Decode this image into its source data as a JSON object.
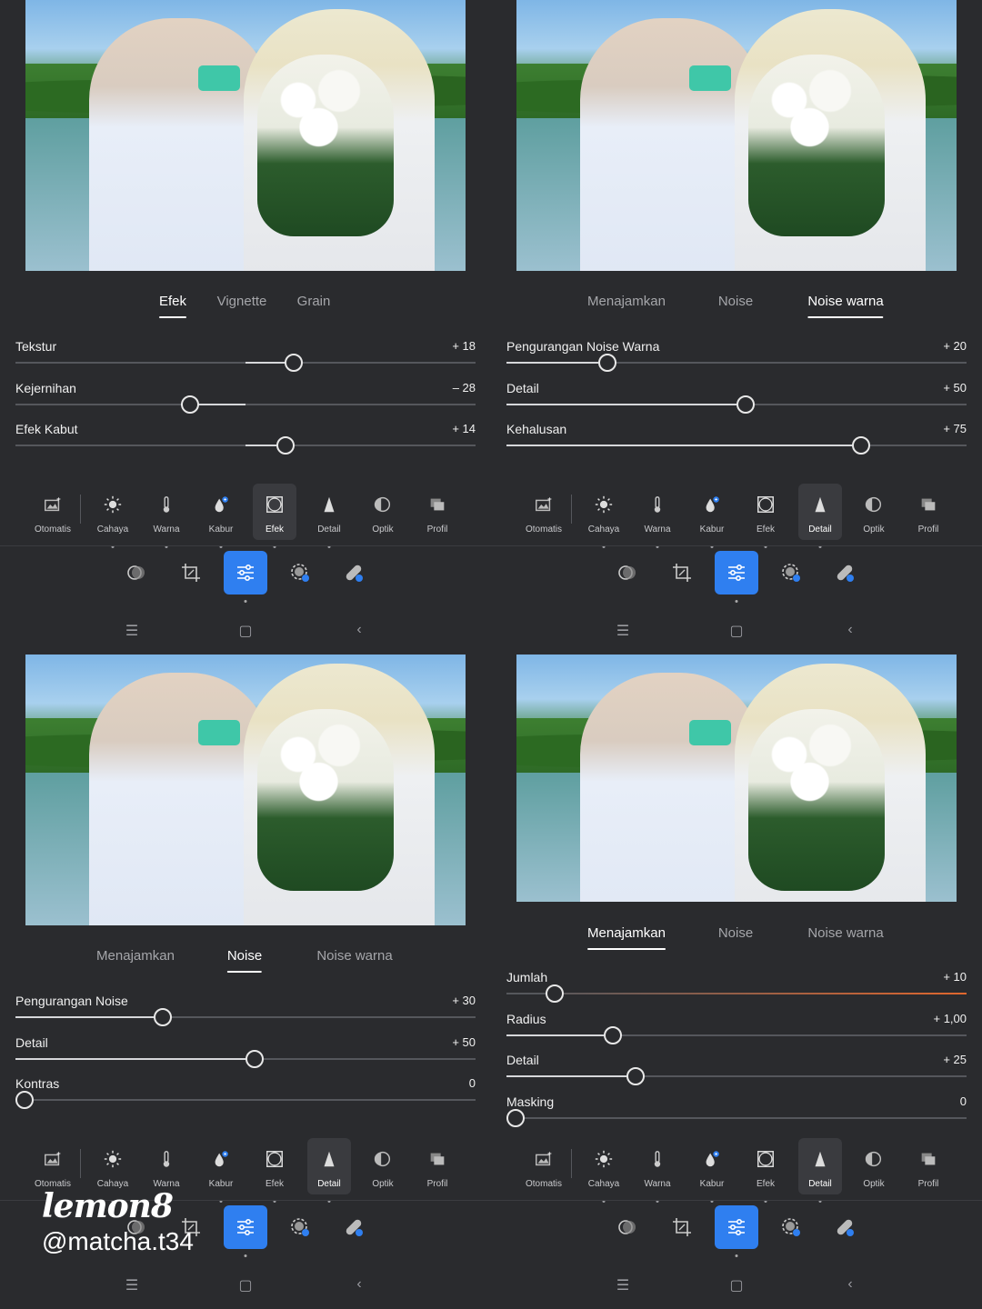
{
  "toolbar": [
    {
      "id": "otomatis",
      "label": "Otomatis",
      "icon": "auto-photo-icon"
    },
    {
      "id": "cahaya",
      "label": "Cahaya",
      "icon": "sun-icon"
    },
    {
      "id": "warna",
      "label": "Warna",
      "icon": "thermometer-icon"
    },
    {
      "id": "kabur",
      "label": "Kabur",
      "icon": "blur-drop-icon"
    },
    {
      "id": "efek",
      "label": "Efek",
      "icon": "vignette-frame-icon"
    },
    {
      "id": "detail",
      "label": "Detail",
      "icon": "triangle-detail-icon"
    },
    {
      "id": "optik",
      "label": "Optik",
      "icon": "lens-icon"
    },
    {
      "id": "profil",
      "label": "Profil",
      "icon": "profile-stack-icon"
    }
  ],
  "bottom_tools": [
    "presets-icon",
    "crop-icon",
    "edit-sliders-icon",
    "masking-icon",
    "healing-icon"
  ],
  "nav": {
    "menu": "☰",
    "home": "▢",
    "back": "‹"
  },
  "panels": [
    {
      "active_tool": "efek",
      "tabs": [
        "Efek",
        "Vignette",
        "Grain"
      ],
      "active_tab": 0,
      "sliders": [
        {
          "label": "Tekstur",
          "value": "+ 18",
          "pos": 0.585
        },
        {
          "label": "Kejernihan",
          "value": "– 28",
          "pos": 0.36
        },
        {
          "label": "Efek Kabut",
          "value": "+ 14",
          "pos": 0.568
        }
      ]
    },
    {
      "active_tool": "detail",
      "tabs": [
        "Menajamkan",
        "Noise",
        "Noise warna"
      ],
      "active_tab": 2,
      "sliders": [
        {
          "label": "Pengurangan Noise Warna",
          "value": "+ 20",
          "pos": 0.2
        },
        {
          "label": "Detail",
          "value": "+ 50",
          "pos": 0.5
        },
        {
          "label": "Kehalusan",
          "value": "+ 75",
          "pos": 0.75
        }
      ]
    },
    {
      "active_tool": "detail",
      "tabs": [
        "Menajamkan",
        "Noise",
        "Noise warna"
      ],
      "active_tab": 1,
      "sliders": [
        {
          "label": "Pengurangan Noise",
          "value": "+ 30",
          "pos": 0.3
        },
        {
          "label": "Detail",
          "value": "+ 50",
          "pos": 0.5
        },
        {
          "label": "Kontras",
          "value": "0",
          "pos": 0.0
        }
      ]
    },
    {
      "active_tool": "detail",
      "tabs": [
        "Menajamkan",
        "Noise",
        "Noise warna"
      ],
      "active_tab": 0,
      "sliders": [
        {
          "label": "Jumlah",
          "value": "+ 10",
          "pos": 0.085,
          "accent": "#e0672e"
        },
        {
          "label": "Radius",
          "value": "+ 1,00",
          "pos": 0.212
        },
        {
          "label": "Detail",
          "value": "+ 25",
          "pos": 0.26
        },
        {
          "label": "Masking",
          "value": "0",
          "pos": 0.0
        }
      ]
    }
  ],
  "watermark": {
    "logo": "lemon8",
    "handle": "@matcha.t34"
  }
}
